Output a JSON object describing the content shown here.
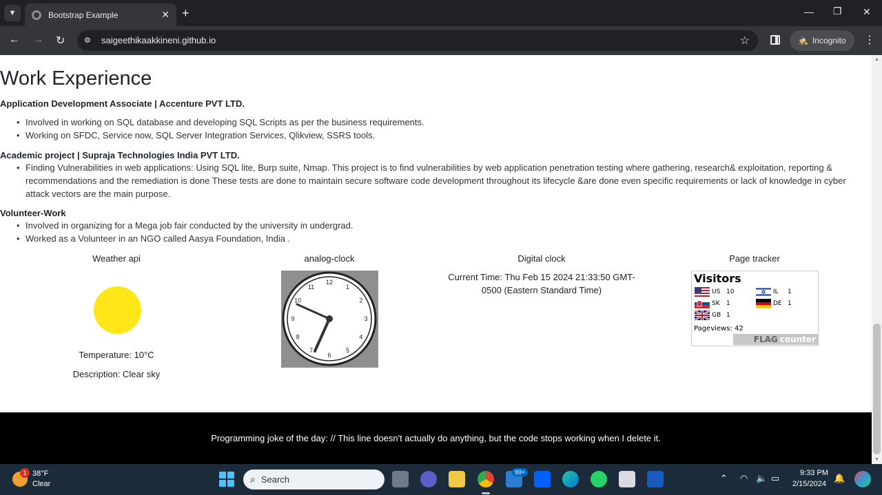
{
  "browser": {
    "tab_title": "Bootstrap Example",
    "url": "saigeethikaakkineni.github.io",
    "incognito_label": "Incognito"
  },
  "page": {
    "section_title": "Work Experience",
    "jobs": [
      {
        "title": "Application Development Associate | Accenture PVT LTD.",
        "bullets": [
          "Involved in working on SQL database and developing SQL Scripts as per the business requirements.",
          "Working on SFDC, Service now, SQL Server Integration Services, Qlikview, SSRS tools."
        ]
      },
      {
        "title": "Academic project | Supraja Technologies India PVT LTD.",
        "bullets": [
          "Finding Vulnerabilities in web applications: Using SQL lite, Burp suite, Nmap. This project is to find vulnerabilities by web application penetration testing where gathering, research& exploitation, reporting & recommendations and the remediation is done These tests are done to maintain secure software code development throughout its lifecycle &are done even specific requirements or lack of knowledge in cyber attack vectors are the main purpose."
        ]
      },
      {
        "title": "Volunteer-Work",
        "bullets": [
          "Involved in organizing for a Mega job fair conducted by the university in undergrad.",
          "Worked as a Volunteer in an NGO called Aasya Foundation, India ."
        ]
      }
    ],
    "weather": {
      "title": "Weather api",
      "temperature": "Temperature: 10°C",
      "description": "Description: Clear sky",
      "sun_color": "#ffe619"
    },
    "analog_clock": {
      "title": "analog-clock",
      "numerals": [
        "12",
        "1",
        "2",
        "3",
        "4",
        "5",
        "6",
        "7",
        "8",
        "9",
        "10",
        "11"
      ]
    },
    "digital_clock": {
      "title": "Digital clock",
      "line1": "Current Time: Thu Feb 15 2024 21:33:50 GMT-",
      "line2": "0500 (Eastern Standard Time)"
    },
    "page_tracker": {
      "title": "Page tracker",
      "counter_title": "Visitors",
      "countries": [
        {
          "code": "US",
          "count": "10"
        },
        {
          "code": "SK",
          "count": "1"
        },
        {
          "code": "GB",
          "count": "1"
        },
        {
          "code": "IL",
          "count": "1"
        },
        {
          "code": "DE",
          "count": "1"
        }
      ],
      "pageviews_label": "Pageviews:",
      "pageviews_value": "42",
      "brand_flag": "FLAG",
      "brand_counter": "counter"
    },
    "footer_joke": "Programming joke of the day: // This line doesn't actually do anything, but the code stops working when I delete it."
  },
  "taskbar": {
    "weather_temp": "38°F",
    "weather_cond": "Clear",
    "weather_badge": "1",
    "search_label": "Search",
    "mail_badge": "99+",
    "time": "9:33 PM",
    "date": "2/15/2024"
  }
}
